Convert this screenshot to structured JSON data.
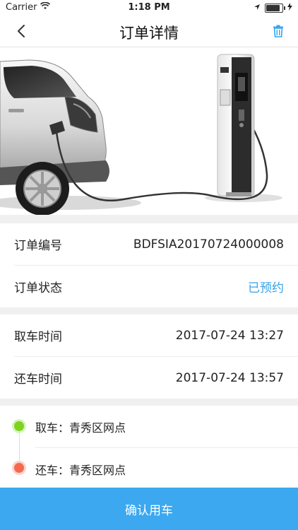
{
  "status_bar": {
    "carrier": "Carrier",
    "time": "1:18 PM"
  },
  "nav": {
    "title": "订单详情"
  },
  "order": {
    "number_label": "订单编号",
    "number_value": "BDFSIA20170724000008",
    "status_label": "订单状态",
    "status_value": "已预约",
    "status_color": "#37a2e8"
  },
  "times": {
    "pickup_label": "取车时间",
    "pickup_value": "2017-07-24 13:27",
    "return_label": "还车时间",
    "return_value": "2017-07-24 13:57"
  },
  "locations": {
    "pickup": "取车：青秀区网点",
    "pickup_dot_color": "#7ed321",
    "return": "还车：青秀区网点",
    "return_dot_color": "#f26b50"
  },
  "footer": {
    "confirm_label": "确认用车",
    "button_color": "#3ba8f0"
  }
}
